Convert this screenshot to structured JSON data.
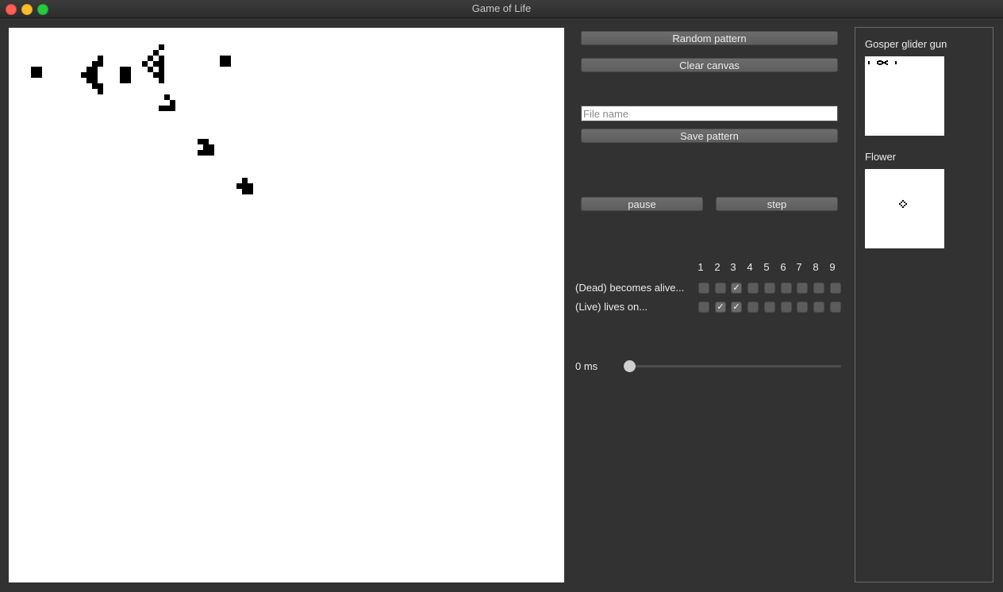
{
  "window": {
    "title": "Game of Life"
  },
  "controls": {
    "random_label": "Random pattern",
    "clear_label": "Clear canvas",
    "file_placeholder": "File name",
    "file_value": "",
    "save_label": "Save pattern",
    "pause_label": "pause",
    "step_label": "step"
  },
  "rules": {
    "numbers": [
      "1",
      "2",
      "3",
      "4",
      "5",
      "6",
      "7",
      "8",
      "9"
    ],
    "birth_label": "(Dead) becomes alive...",
    "birth": [
      false,
      false,
      true,
      false,
      false,
      false,
      false,
      false,
      false
    ],
    "survive_label": "(Live) lives on...",
    "survive": [
      false,
      true,
      true,
      false,
      false,
      false,
      false,
      false,
      false
    ]
  },
  "speed": {
    "label": "0 ms",
    "value": 0
  },
  "presets": {
    "gosper_title": "Gosper glider gun",
    "flower_title": "Flower"
  },
  "colors": {
    "window_bg": "#323232",
    "alive": "#000000",
    "dead": "#ffffff"
  }
}
